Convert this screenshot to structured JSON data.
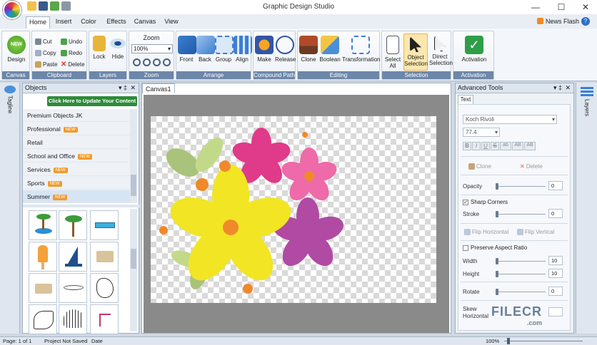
{
  "window": {
    "title": "Graphic Design Studio"
  },
  "tabs": [
    "Home",
    "Insert",
    "Color",
    "Effects",
    "Canvas",
    "View"
  ],
  "news_flash": "News Flash",
  "ribbon": {
    "canvas": {
      "label": "Canvas",
      "design": "Design"
    },
    "clipboard": {
      "label": "Clipboard",
      "cut": "Cut",
      "copy": "Copy",
      "paste": "Paste",
      "undo": "Undo",
      "redo": "Redo",
      "delete": "Delete"
    },
    "layers": {
      "label": "Layers",
      "lock": "Lock",
      "hide": "Hide"
    },
    "zoom": {
      "label": "Zoom",
      "title": "Zoom",
      "value": "100%"
    },
    "arrange": {
      "label": "Arrange",
      "front": "Front",
      "back": "Back",
      "group": "Group",
      "align": "Align"
    },
    "compound": {
      "label": "Compound Path",
      "make": "Make",
      "release": "Release"
    },
    "editing": {
      "label": "Editing",
      "clone": "Clone",
      "boolean": "Boolean",
      "transformation": "Transformation"
    },
    "selection": {
      "label": "Selection",
      "select_all": "Select All",
      "object_selection": "Object Selection",
      "direct_selection": "Direct Selection"
    },
    "activation": {
      "label": "Activation",
      "activation": "Activation"
    }
  },
  "left_strip": {
    "tagline": "Tagline"
  },
  "objects_panel": {
    "title": "Objects",
    "update_button": "Click Here to Update Your Content",
    "categories": [
      {
        "name": "Premium Objects JK",
        "new": false
      },
      {
        "name": "Professional",
        "new": true
      },
      {
        "name": "Retail",
        "new": false
      },
      {
        "name": "School and Office",
        "new": true
      },
      {
        "name": "Services",
        "new": true
      },
      {
        "name": "Sports",
        "new": true
      },
      {
        "name": "Summer",
        "new": true
      }
    ],
    "new_badge": "NEW"
  },
  "canvas": {
    "tab": "Canvas1"
  },
  "advanced": {
    "title": "Advanced Tools",
    "tab": "Text",
    "font": "Koch Rivoli",
    "font_size": "77.4",
    "format_buttons": [
      "B",
      "I",
      "U",
      "S",
      "ab",
      "AB",
      "AB"
    ],
    "clone": "Clone",
    "delete": "Delete",
    "opacity": {
      "label": "Opacity",
      "value": "0"
    },
    "sharp_corners": "Sharp Corners",
    "stroke": {
      "label": "Stroke",
      "value": "0"
    },
    "flip_horizontal": "Flip Horizontal",
    "flip_vertical": "Flip Vertical",
    "preserve_aspect": "Preserve Aspect Ratio",
    "width": {
      "label": "Width",
      "value": "10"
    },
    "height": {
      "label": "Height",
      "value": "10"
    },
    "rotate": {
      "label": "Rotate",
      "value": "0"
    },
    "skew_h": {
      "label": "Skew Horizontal",
      "value": ""
    }
  },
  "right_strip": {
    "layers": "Layers"
  },
  "status": {
    "page": "Page: 1 of 1",
    "project": "Project Not Saved",
    "date": "Date",
    "zoom": "100%"
  },
  "watermark": {
    "brand": "FILECR",
    "domain": ".com"
  }
}
